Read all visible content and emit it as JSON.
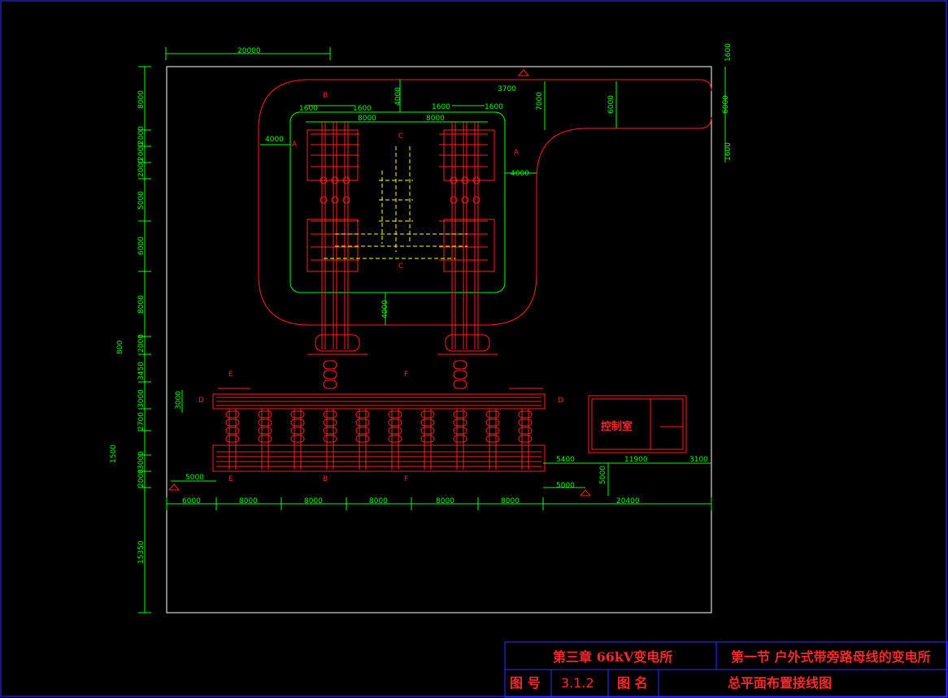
{
  "drawing": {
    "control_room_label": "控制室",
    "section_marks": {
      "A": "A",
      "B": "B",
      "C": "C",
      "D": "D",
      "E": "E",
      "F": "F"
    },
    "dimensions": {
      "top_width": "20000",
      "top_bus_span_left": "8000",
      "top_bus_span_right": "8000",
      "top_offset_left_a": "1600",
      "top_offset_left_b": "1600",
      "top_offset_right_a": "1600",
      "top_offset_right_b": "1600",
      "road_left": "4000",
      "road_right": "4000",
      "road_top_vertical": "4000",
      "road_bottom_vertical": "4000",
      "road_width_right": "3700",
      "road_height_right": "7000",
      "entrance_width": "6000",
      "right_side_top": "1600",
      "right_side_mid": "6000",
      "right_side_bottom": "1600",
      "left_v_1": "8000",
      "left_v_2": "2000",
      "left_v_3": "2000",
      "left_v_4": "2000",
      "left_v_5": "5000",
      "left_v_6": "6000",
      "left_v_7": "8000",
      "left_v_8": "2000",
      "left_v_9": "3450",
      "left_v_10": "3000",
      "left_v_11": "2700",
      "left_v_12": "3000",
      "left_v_13": "2000",
      "left_v_14": "15350",
      "left_small_800": "800",
      "left_small_1500": "1500",
      "bus_height": "3000",
      "bottom_offset": "5000",
      "bottom_right_offset": "5000",
      "control_room_v": "5000",
      "control_room_left": "5400",
      "control_room_width": "11900",
      "control_room_right": "3100",
      "bottom_1": "6000",
      "bottom_2": "8000",
      "bottom_3": "8000",
      "bottom_4": "8000",
      "bottom_5": "8000",
      "bottom_6": "8000",
      "bottom_7": "20400"
    }
  },
  "title_block": {
    "chapter": "第三章  66kV变电所",
    "section": "第一节  户外式带旁路母线的变电所",
    "drawing_no_label": "图  号",
    "drawing_no": "3.1.2",
    "drawing_name_label": "图  名",
    "drawing_name": "总平面布置接线图"
  },
  "colors": {
    "background": "#000000",
    "dimension": "#00ff00",
    "equipment": "#ff2020",
    "frame": "#ffffff",
    "dashed_cable": "#ffff00",
    "title_border": "#3030ff"
  }
}
